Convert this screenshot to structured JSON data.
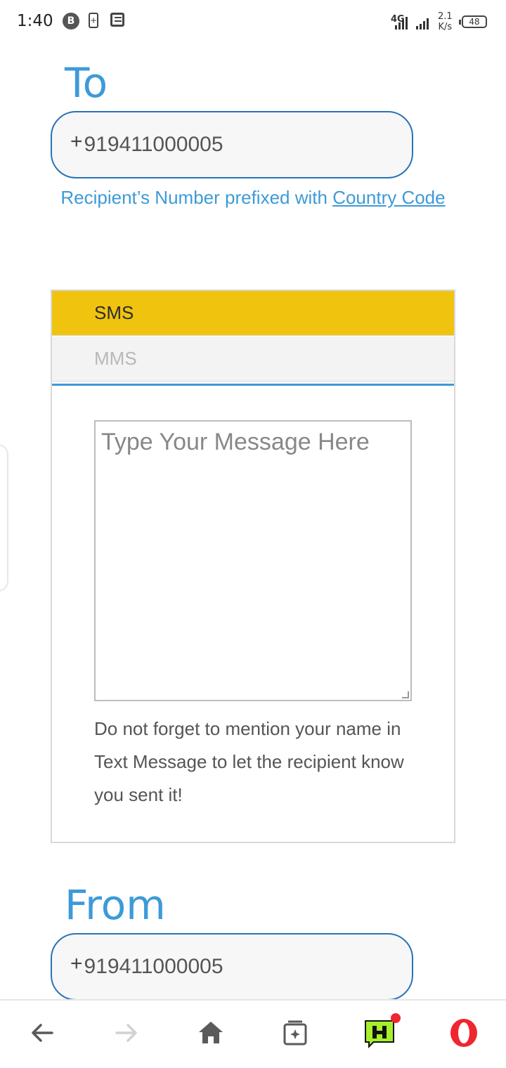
{
  "status_bar": {
    "time": "1:40",
    "network": "4G",
    "speed_value": "2.1",
    "speed_unit": "K/s",
    "battery_level": "48"
  },
  "to_section": {
    "title": "To",
    "phone_prefix": "+",
    "phone_value": "919411000005"
  },
  "helper": {
    "text": "Recipient’s Number prefixed with ",
    "link_text": "Country Code"
  },
  "tabs": {
    "sms_label": "SMS",
    "mms_label": "MMS",
    "active": "SMS"
  },
  "message": {
    "placeholder": "Type Your Message Here",
    "note": "Do not forget to mention your name in Text Message to let the recipient know you sent it!"
  },
  "from_section": {
    "title": "From",
    "phone_prefix": "+",
    "phone_value": "919411000005"
  },
  "bottom_nav": {
    "icons": [
      "back-arrow-icon",
      "forward-arrow-icon",
      "home-icon",
      "tabs-icon",
      "hype-icon",
      "opera-icon"
    ]
  },
  "colors": {
    "accent_blue": "#3d9ad8",
    "sms_tab": "#f0c30f",
    "border_blue": "#2a73b8",
    "opera_red": "#ef2530"
  }
}
